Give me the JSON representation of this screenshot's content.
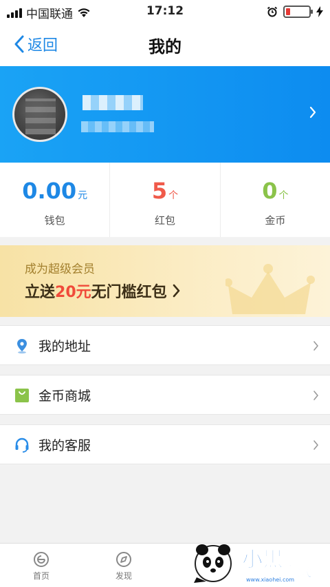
{
  "status_bar": {
    "carrier": "中国联通",
    "time": "17:12",
    "battery_level": 0.2
  },
  "nav": {
    "back_label": "返回",
    "title": "我的"
  },
  "stats": [
    {
      "value": "0.00",
      "unit": "元",
      "label": "钱包",
      "color": "#1e88e5"
    },
    {
      "value": "5",
      "unit": "个",
      "label": "红包",
      "color": "#f05a4a"
    },
    {
      "value": "0",
      "unit": "个",
      "label": "金币",
      "color": "#8bc34a"
    }
  ],
  "promo": {
    "subtitle": "成为超级会员",
    "main_prefix": "立送",
    "main_highlight": "20元",
    "main_suffix": "无门槛红包"
  },
  "menu": [
    {
      "label": "我的地址",
      "icon": "location-pin-icon",
      "icon_color": "#3b8fe0"
    },
    {
      "label": "金币商城",
      "icon": "shopping-bag-icon",
      "icon_color": "#8bc34a"
    },
    {
      "label": "我的客服",
      "icon": "headset-icon",
      "icon_color": "#2a8de8"
    }
  ],
  "tabs": [
    {
      "label": "首页",
      "icon": "home-e-icon"
    },
    {
      "label": "发现",
      "icon": "compass-icon"
    }
  ],
  "watermark": {
    "logo_text": "小黑游戏",
    "logo_domain": "www.xiaohei.com"
  }
}
